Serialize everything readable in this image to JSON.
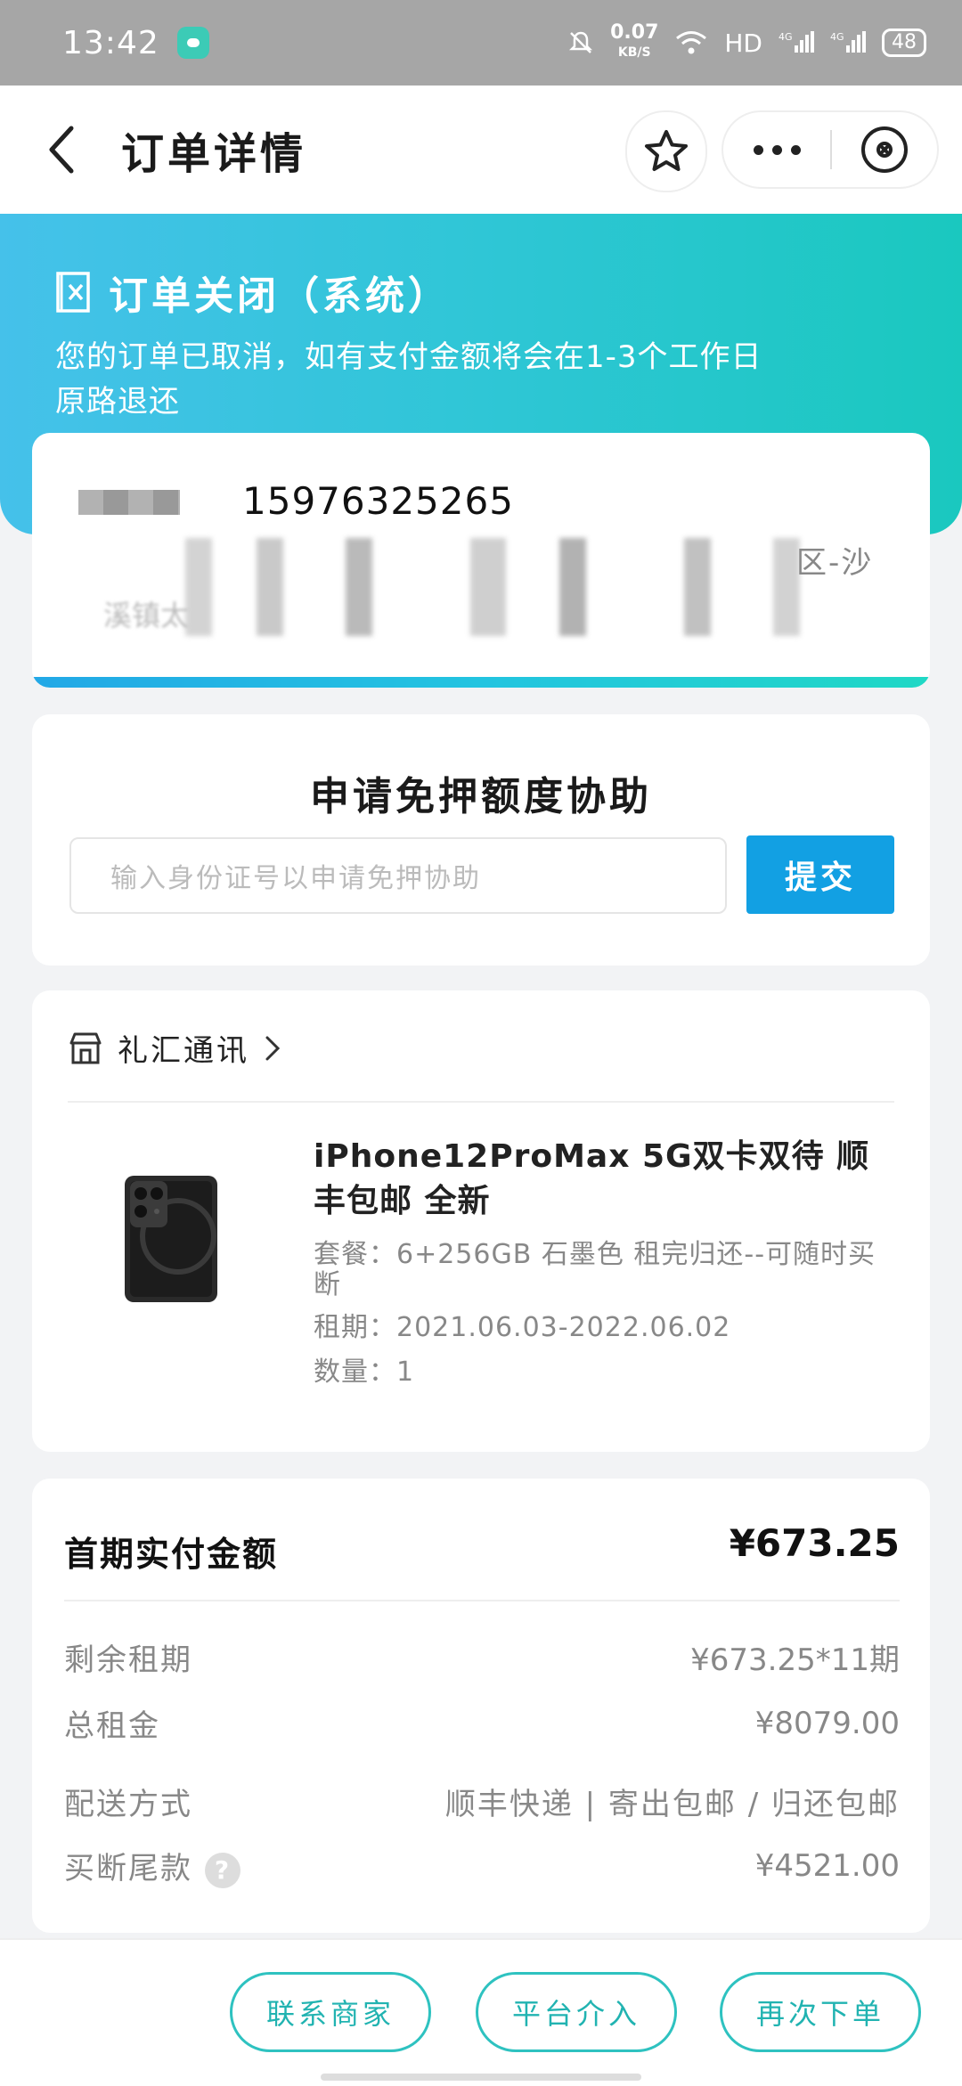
{
  "status_bar": {
    "time": "13:42",
    "net_speed_value": "0.07",
    "net_speed_unit": "KB/S",
    "hd_label": "HD",
    "battery": "48"
  },
  "nav": {
    "title": "订单详情"
  },
  "banner": {
    "title": "订单关闭（系统）",
    "description": "您的订单已取消，如有支付金额将会在1-3个工作日原路退还"
  },
  "address": {
    "phone": "15976325265",
    "line1_tail": "区-沙",
    "line2_head": "溪镇太"
  },
  "deposit": {
    "title": "申请免押额度协助",
    "input_placeholder": "输入身份证号以申请免押协助",
    "submit_label": "提交"
  },
  "product": {
    "shop_name": "礼汇通讯",
    "title": "iPhone12ProMax 5G双卡双待 顺丰包邮 全新",
    "package": "套餐：6+256GB 石墨色 租完归还--可随时买断",
    "rental_period": "租期：2021.06.03-2022.06.02",
    "quantity": "数量：1"
  },
  "payment": {
    "first_label": "首期实付金额",
    "first_value": "¥673.25",
    "rows": [
      {
        "label": "剩余租期",
        "value": "¥673.25*11期"
      },
      {
        "label": "总租金",
        "value": "¥8079.00"
      },
      {
        "label": "配送方式",
        "value": "顺丰快递 | 寄出包邮 / 归还包邮"
      },
      {
        "label": "买断尾款",
        "value": "¥4521.00"
      }
    ],
    "help_symbol": "?"
  },
  "actions": {
    "contact": "联系商家",
    "platform": "平台介入",
    "reorder": "再次下单"
  },
  "colors": {
    "accent_teal": "#2ec2c0",
    "submit_blue": "#12a0e3",
    "banner_start": "#45c1ea",
    "banner_end": "#1ac8bf"
  }
}
